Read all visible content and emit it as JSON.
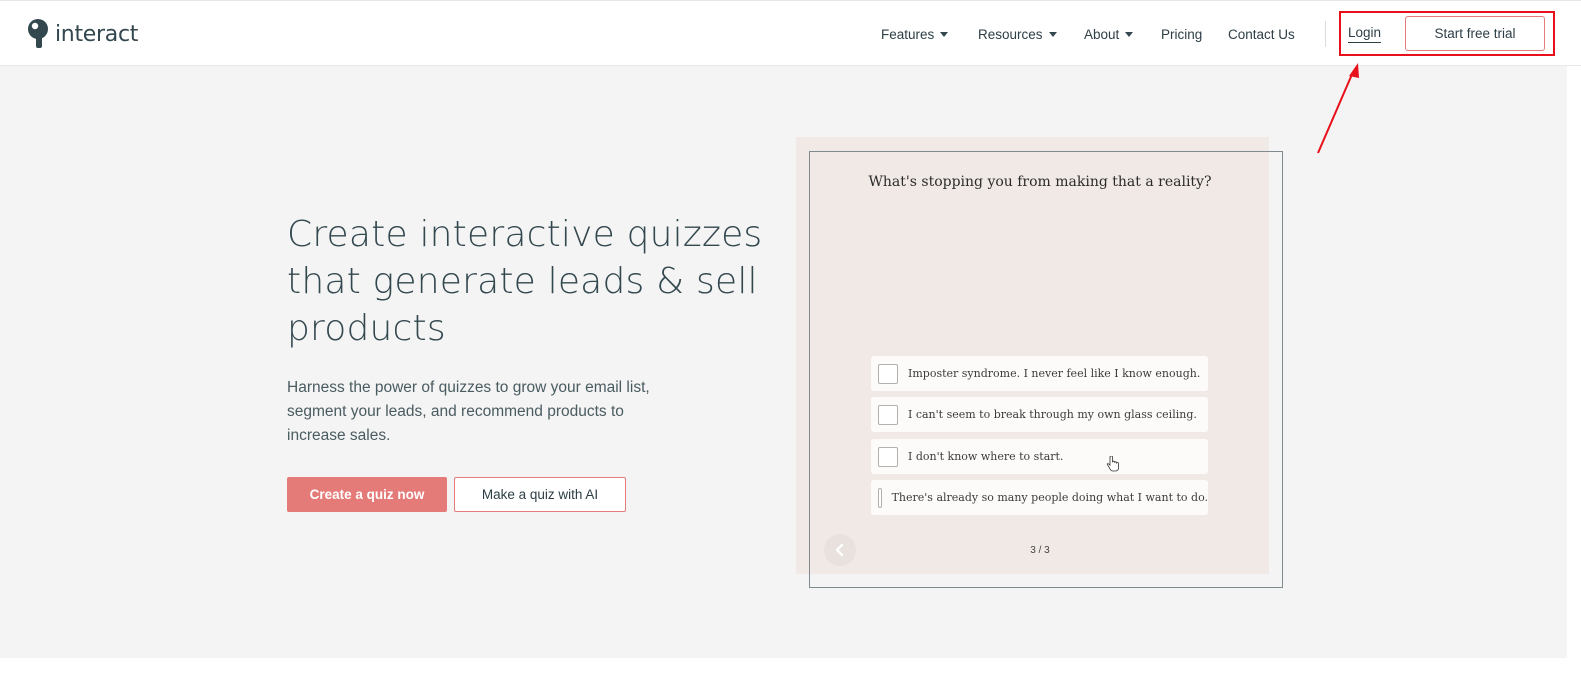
{
  "header": {
    "logo_text": "interact",
    "nav": [
      {
        "label": "Features",
        "has_dropdown": true
      },
      {
        "label": "Resources",
        "has_dropdown": true
      },
      {
        "label": "About",
        "has_dropdown": true
      },
      {
        "label": "Pricing",
        "has_dropdown": false
      },
      {
        "label": "Contact Us",
        "has_dropdown": false
      }
    ],
    "login_label": "Login",
    "trial_label": "Start free trial"
  },
  "hero": {
    "headline": "Create interactive quizzes that generate leads & sell products",
    "subtext": "Harness the power of quizzes to grow your email list, segment your leads, and recommend products to increase sales.",
    "primary_cta": "Create a quiz now",
    "secondary_cta": "Make a quiz with AI"
  },
  "quiz": {
    "question": "What's stopping you from making that a reality?",
    "options": [
      "Imposter syndrome. I never feel like I know enough.",
      "I can't seem to break through my own glass ceiling.",
      "I don't know where to start.",
      "There's already so many people doing what I want to do."
    ],
    "pager": "3 / 3"
  },
  "colors": {
    "brand_text": "#33474f",
    "accent": "#e57b78",
    "annotation": "#e8101a",
    "hero_bg": "#f3f4f3",
    "quiz_bg": "#f1e9e5"
  }
}
